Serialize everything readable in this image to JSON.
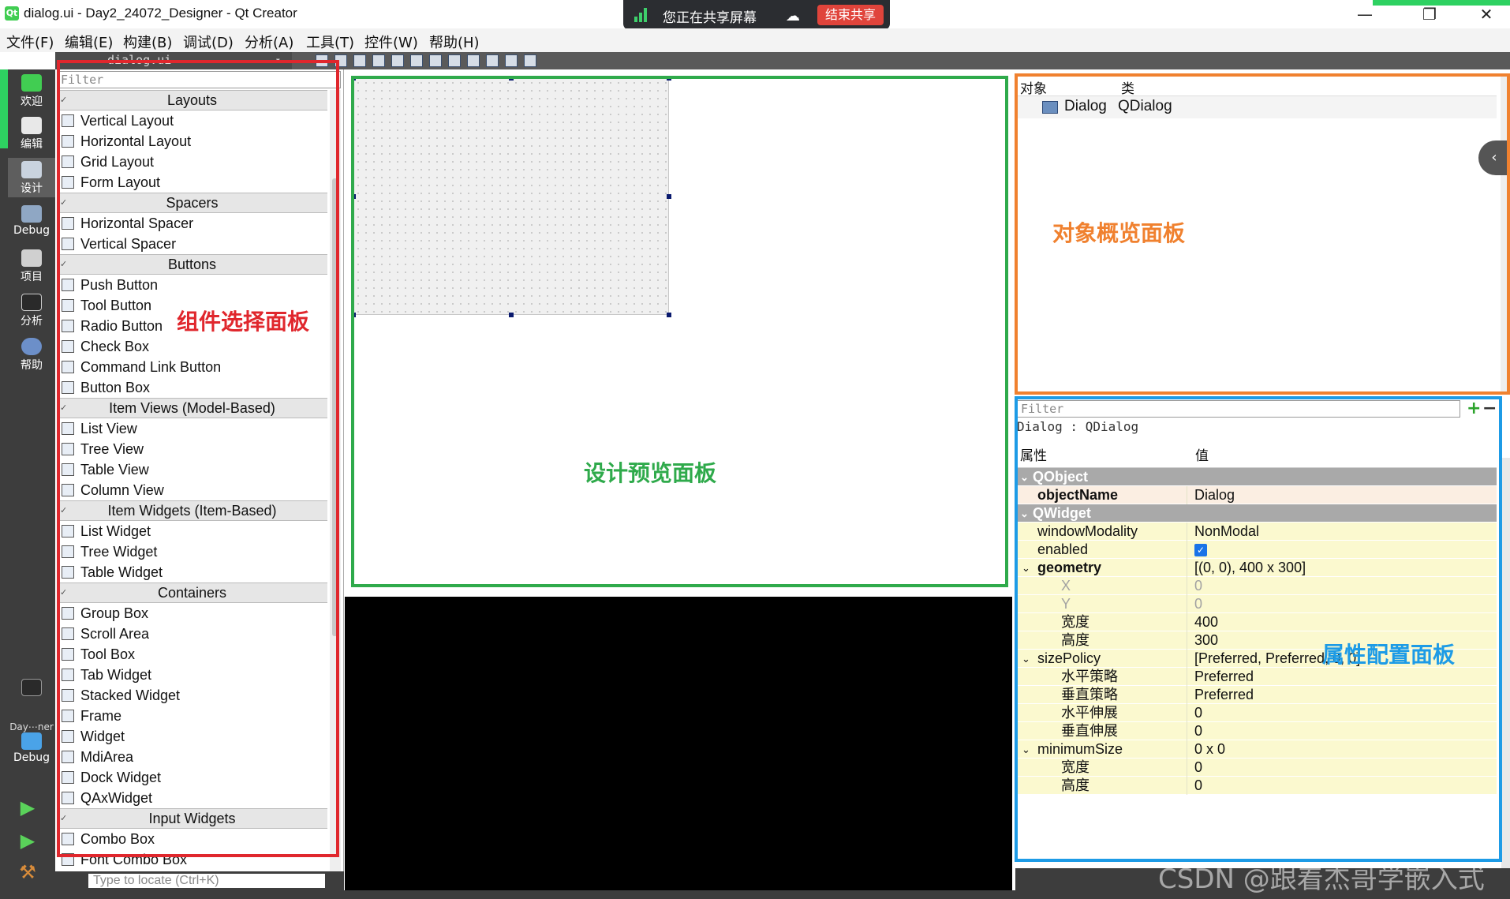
{
  "window": {
    "title": "dialog.ui - Day2_24072_Designer - Qt Creator",
    "controls": [
      "—",
      "❐",
      "✕"
    ]
  },
  "share_bar": {
    "status_text": "您正在共享屏幕",
    "end_button": "结束共享",
    "accent": "#e0443b"
  },
  "menu": {
    "items": [
      "文件(F)",
      "编辑(E)",
      "构建(B)",
      "调试(D)",
      "分析(A)",
      "工具(T)",
      "控件(W)",
      "帮助(H)"
    ]
  },
  "toolbar": {
    "open_file": "dialog.ui"
  },
  "modebar": {
    "modes": [
      "欢迎",
      "编辑",
      "设计",
      "Debug",
      "项目",
      "分析",
      "帮助"
    ],
    "active_mode": "设计",
    "kit_label": "Day⋯ner",
    "kit_mode": "Debug",
    "accent": "#2ed161"
  },
  "widget_box": {
    "filter_placeholder": "Filter",
    "categories": [
      {
        "name": "Layouts",
        "items": [
          "Vertical Layout",
          "Horizontal Layout",
          "Grid Layout",
          "Form Layout"
        ]
      },
      {
        "name": "Spacers",
        "items": [
          "Horizontal Spacer",
          "Vertical Spacer"
        ]
      },
      {
        "name": "Buttons",
        "items": [
          "Push Button",
          "Tool Button",
          "Radio Button",
          "Check Box",
          "Command Link Button",
          "Button Box"
        ]
      },
      {
        "name": "Item Views (Model-Based)",
        "items": [
          "List View",
          "Tree View",
          "Table View",
          "Column View"
        ]
      },
      {
        "name": "Item Widgets (Item-Based)",
        "items": [
          "List Widget",
          "Tree Widget",
          "Table Widget"
        ]
      },
      {
        "name": "Containers",
        "items": [
          "Group Box",
          "Scroll Area",
          "Tool Box",
          "Tab Widget",
          "Stacked Widget",
          "Frame",
          "Widget",
          "MdiArea",
          "Dock Widget",
          "QAxWidget"
        ]
      },
      {
        "name": "Input Widgets",
        "items": [
          "Combo Box",
          "Font Combo Box"
        ]
      }
    ],
    "locate_placeholder": "Type to locate (Ctrl+K)"
  },
  "object_inspector": {
    "col_object": "对象",
    "col_class": "类",
    "rows": [
      {
        "object": "Dialog",
        "class": "QDialog"
      }
    ]
  },
  "property_editor": {
    "filter_placeholder": "Filter",
    "class_label": "Dialog : QDialog",
    "col_property": "属性",
    "col_value": "值",
    "groups": [
      {
        "name": "QObject",
        "rows": [
          {
            "name": "objectName",
            "value": "Dialog",
            "bold": true
          }
        ]
      },
      {
        "name": "QWidget",
        "rows": [
          {
            "name": "windowModality",
            "value": "NonModal"
          },
          {
            "name": "enabled",
            "value": "✓",
            "checkbox": true
          },
          {
            "name": "geometry",
            "value": "[(0, 0), 400 x 300]",
            "bold": true,
            "expanded": true
          },
          {
            "name": "X",
            "value": "0",
            "sub": true,
            "dim": true
          },
          {
            "name": "Y",
            "value": "0",
            "sub": true,
            "dim": true
          },
          {
            "name": "宽度",
            "value": "400",
            "sub": true
          },
          {
            "name": "高度",
            "value": "300",
            "sub": true
          },
          {
            "name": "sizePolicy",
            "value": "[Preferred, Preferred, 0, 0]",
            "expanded": true
          },
          {
            "name": "水平策略",
            "value": "Preferred",
            "sub": true
          },
          {
            "name": "垂直策略",
            "value": "Preferred",
            "sub": true
          },
          {
            "name": "水平伸展",
            "value": "0",
            "sub": true
          },
          {
            "name": "垂直伸展",
            "value": "0",
            "sub": true
          },
          {
            "name": "minimumSize",
            "value": "0 x 0",
            "expanded": true
          },
          {
            "name": "宽度",
            "value": "0",
            "sub": true
          },
          {
            "name": "高度",
            "value": "0",
            "sub": true
          }
        ]
      }
    ]
  },
  "annotations": {
    "widget_box": "组件选择面板",
    "design_preview": "设计预览面板",
    "object_overview": "对象概览面板",
    "property_config": "属性配置面板",
    "colors": {
      "red": "#e0272d",
      "green": "#2faa4b",
      "orange": "#f0812f",
      "blue": "#1d9be6"
    }
  },
  "watermark": "CSDN @跟着杰哥学嵌入式"
}
